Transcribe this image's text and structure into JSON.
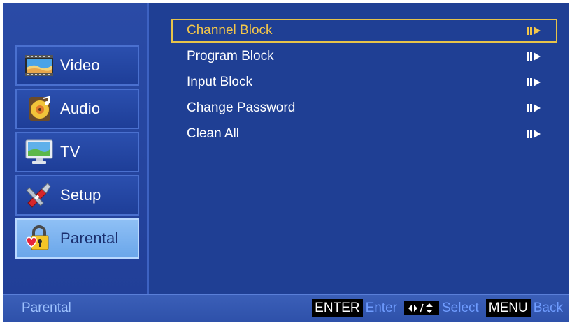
{
  "sidebar": {
    "items": [
      {
        "label": "Video",
        "icon": "video-icon"
      },
      {
        "label": "Audio",
        "icon": "audio-icon"
      },
      {
        "label": "TV",
        "icon": "tv-icon"
      },
      {
        "label": "Setup",
        "icon": "setup-icon"
      },
      {
        "label": "Parental",
        "icon": "parental-lock-icon",
        "active": true
      }
    ]
  },
  "menu": {
    "items": [
      {
        "label": "Channel Block",
        "selected": true,
        "icon": "submenu-arrow-icon"
      },
      {
        "label": "Program Block",
        "icon": "submenu-arrow-icon"
      },
      {
        "label": "Input Block",
        "icon": "submenu-arrow-icon"
      },
      {
        "label": "Change Password",
        "icon": "submenu-arrow-icon"
      },
      {
        "label": "Clean All",
        "icon": "submenu-arrow-icon"
      }
    ]
  },
  "footer": {
    "title": "Parental",
    "hints": {
      "enter_key": "ENTER",
      "enter_label": "Enter",
      "nav_icon": "arrows-icon",
      "select_label": "Select",
      "menu_key": "MENU",
      "back_label": "Back"
    }
  },
  "colors": {
    "background": "#1f3f94",
    "selection_border": "#e6c34a",
    "selected_text": "#f3c64a",
    "active_sidebar": "#7db4f0",
    "hint_text": "#6f9cff",
    "footer_title": "#9fc3ff"
  }
}
